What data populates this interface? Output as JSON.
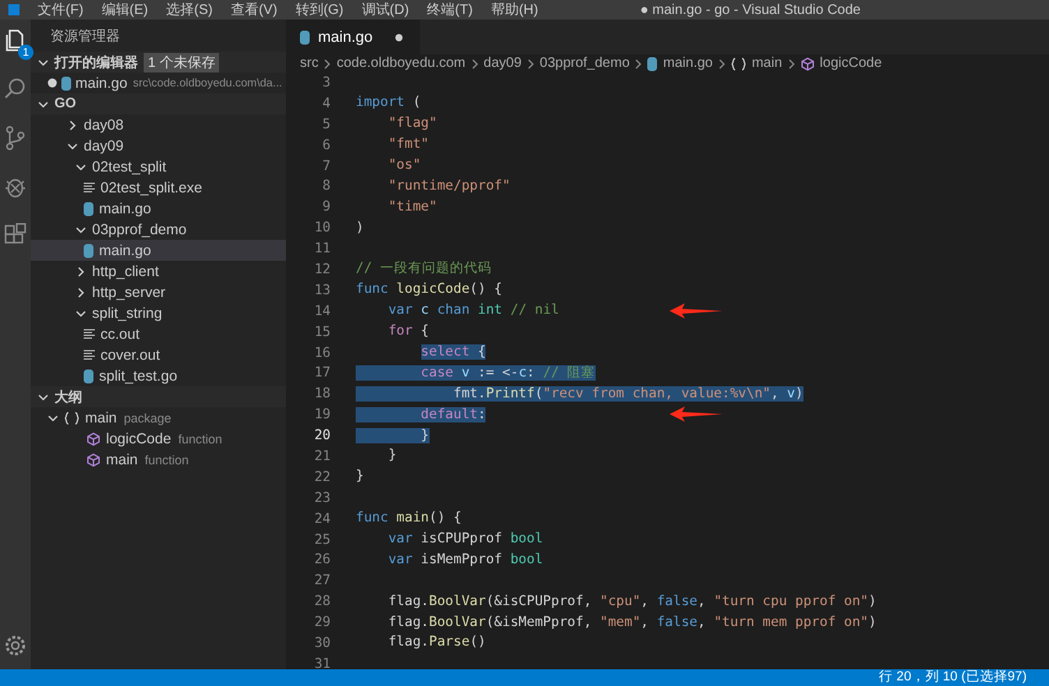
{
  "menu_bar": {
    "items": [
      "文件(F)",
      "编辑(E)",
      "选择(S)",
      "查看(V)",
      "转到(G)",
      "调试(D)",
      "终端(T)",
      "帮助(H)"
    ],
    "title": "● main.go - go - Visual Studio Code"
  },
  "activity_bar": {
    "items": [
      {
        "kind": "files",
        "badge": "1",
        "selected": true
      },
      {
        "kind": "search",
        "selected": false
      },
      {
        "kind": "source-control",
        "selected": false
      },
      {
        "kind": "debug",
        "selected": false
      },
      {
        "kind": "extensions",
        "selected": false
      }
    ],
    "bottom": [
      {
        "kind": "settings"
      }
    ]
  },
  "sidebar": {
    "title": "资源管理器",
    "open_editors": {
      "title": "打开的编辑器",
      "badge": "1 个未保存",
      "expanded": true,
      "items": [
        {
          "name": "main.go",
          "path": "src\\code.oldboyedu.com\\da...",
          "dirty": true
        }
      ]
    },
    "folder": {
      "title": "GO",
      "expanded": true,
      "items": [
        {
          "name": "day08",
          "kind": "folder",
          "expanded": false,
          "selected": false
        },
        {
          "name": "day09",
          "kind": "folder",
          "expanded": true,
          "selected": false,
          "children": [
            {
              "name": "02test_split",
              "kind": "folder",
              "expanded": true,
              "selected": false,
              "children": [
                {
                  "name": "02test_split.exe",
                  "kind": "file",
                  "selected": false
                },
                {
                  "name": "main.go",
                  "kind": "go",
                  "selected": false
                }
              ]
            },
            {
              "name": "03pprof_demo",
              "kind": "folder",
              "expanded": true,
              "selected": false,
              "children": [
                {
                  "name": "main.go",
                  "kind": "go",
                  "selected": true
                }
              ]
            },
            {
              "name": "http_client",
              "kind": "folder",
              "expanded": false,
              "selected": false
            },
            {
              "name": "http_server",
              "kind": "folder",
              "expanded": false,
              "selected": false
            },
            {
              "name": "split_string",
              "kind": "folder",
              "expanded": true,
              "selected": false,
              "children": [
                {
                  "name": "cc.out",
                  "kind": "file",
                  "selected": false
                },
                {
                  "name": "cover.out",
                  "kind": "file",
                  "selected": false
                },
                {
                  "name": "split_test.go",
                  "kind": "go",
                  "selected": false
                }
              ]
            }
          ]
        }
      ]
    },
    "outline": {
      "title": "大纲",
      "expanded": true,
      "items": [
        {
          "name": "main",
          "detail": "package",
          "kind": "package",
          "expanded": true,
          "children": [
            {
              "name": "logicCode",
              "detail": "function",
              "kind": "function"
            },
            {
              "name": "main",
              "detail": "function",
              "kind": "function"
            }
          ]
        }
      ]
    }
  },
  "tabs": [
    {
      "label": "main.go",
      "dirty": true,
      "selected": true
    }
  ],
  "breadcrumb": [
    {
      "label": "src",
      "kind": "folder"
    },
    {
      "label": "code.oldboyedu.com",
      "kind": "folder"
    },
    {
      "label": "day09",
      "kind": "folder"
    },
    {
      "label": "03pprof_demo",
      "kind": "folder"
    },
    {
      "label": "main.go",
      "kind": "go"
    },
    {
      "label": "main",
      "kind": "package"
    },
    {
      "label": "logicCode",
      "kind": "function"
    }
  ],
  "code": [
    {
      "n": "3"
    },
    {
      "n": "4",
      "tokens": [
        {
          "text": "import",
          "kind": "keyword"
        },
        {
          "text": " (",
          "kind": "plain"
        }
      ]
    },
    {
      "n": "5",
      "tokens": [
        {
          "text": "    \"flag\"",
          "kind": "string"
        }
      ]
    },
    {
      "n": "6",
      "tokens": [
        {
          "text": "    \"fmt\"",
          "kind": "string"
        }
      ]
    },
    {
      "n": "7",
      "tokens": [
        {
          "text": "    \"os\"",
          "kind": "string"
        }
      ]
    },
    {
      "n": "8",
      "tokens": [
        {
          "text": "    \"runtime/pprof\"",
          "kind": "string"
        }
      ]
    },
    {
      "n": "9",
      "tokens": [
        {
          "text": "    \"time\"",
          "kind": "string"
        }
      ]
    },
    {
      "n": "10",
      "tokens": [
        {
          "text": ")",
          "kind": "plain"
        }
      ]
    },
    {
      "n": "11"
    },
    {
      "n": "12",
      "tokens": [
        {
          "text": "// 一段有问题的代码",
          "kind": "comment"
        }
      ]
    },
    {
      "n": "13",
      "tokens": [
        {
          "text": "func",
          "kind": "keyword"
        },
        {
          "text": " logicCode",
          "kind": "function"
        },
        {
          "text": "() {",
          "kind": "plain"
        }
      ]
    },
    {
      "n": "14",
      "arrow": true,
      "tokens": [
        {
          "text": "    var",
          "kind": "keyword"
        },
        {
          "text": " c",
          "kind": "variable"
        },
        {
          "text": " chan",
          "kind": "keyword"
        },
        {
          "text": " int",
          "kind": "type"
        },
        {
          "text": " // nil",
          "kind": "comment"
        }
      ]
    },
    {
      "n": "15",
      "tokens": [
        {
          "text": "    for",
          "kind": "control"
        },
        {
          "text": " {",
          "kind": "plain"
        }
      ]
    },
    {
      "n": "16",
      "selected": true,
      "indent_selected": false,
      "tokens": [
        {
          "text": "        select",
          "kind": "control"
        },
        {
          "text": " {",
          "kind": "plain"
        }
      ]
    },
    {
      "n": "17",
      "selected": true,
      "tokens": [
        {
          "text": "        case",
          "kind": "control"
        },
        {
          "text": " v",
          "kind": "variable"
        },
        {
          "text": " := <-",
          "kind": "plain"
        },
        {
          "text": "c",
          "kind": "variable"
        },
        {
          "text": ": ",
          "kind": "plain"
        },
        {
          "text": "// 阻塞",
          "kind": "comment"
        }
      ]
    },
    {
      "n": "18",
      "selected": true,
      "tokens": [
        {
          "text": "            fmt.",
          "kind": "plain"
        },
        {
          "text": "Printf",
          "kind": "function"
        },
        {
          "text": "(",
          "kind": "plain"
        },
        {
          "text": "\"recv from chan, value:%v\\n\"",
          "kind": "string"
        },
        {
          "text": ", ",
          "kind": "plain"
        },
        {
          "text": "v",
          "kind": "variable"
        },
        {
          "text": ")",
          "kind": "plain"
        }
      ]
    },
    {
      "n": "19",
      "selected": true,
      "arrow": true,
      "tokens": [
        {
          "text": "        default",
          "kind": "control"
        },
        {
          "text": ":",
          "kind": "plain"
        }
      ]
    },
    {
      "n": "20",
      "selected": true,
      "current": true,
      "tokens": [
        {
          "text": "        }",
          "kind": "plain"
        }
      ]
    },
    {
      "n": "21",
      "tokens": [
        {
          "text": "    }",
          "kind": "plain"
        }
      ]
    },
    {
      "n": "22",
      "tokens": [
        {
          "text": "}",
          "kind": "plain"
        }
      ]
    },
    {
      "n": "23"
    },
    {
      "n": "24",
      "tokens": [
        {
          "text": "func",
          "kind": "keyword"
        },
        {
          "text": " main",
          "kind": "function"
        },
        {
          "text": "() {",
          "kind": "plain"
        }
      ]
    },
    {
      "n": "25",
      "tokens": [
        {
          "text": "    var",
          "kind": "keyword"
        },
        {
          "text": " isCPUPprof ",
          "kind": "plain"
        },
        {
          "text": "bool",
          "kind": "type"
        }
      ]
    },
    {
      "n": "26",
      "tokens": [
        {
          "text": "    var",
          "kind": "keyword"
        },
        {
          "text": " isMemPprof ",
          "kind": "plain"
        },
        {
          "text": "bool",
          "kind": "type"
        }
      ]
    },
    {
      "n": "27"
    },
    {
      "n": "28",
      "tokens": [
        {
          "text": "    flag.",
          "kind": "plain"
        },
        {
          "text": "BoolVar",
          "kind": "function"
        },
        {
          "text": "(&isCPUPprof, ",
          "kind": "plain"
        },
        {
          "text": "\"cpu\"",
          "kind": "string"
        },
        {
          "text": ", ",
          "kind": "plain"
        },
        {
          "text": "false",
          "kind": "keyword"
        },
        {
          "text": ", ",
          "kind": "plain"
        },
        {
          "text": "\"turn cpu pprof on\"",
          "kind": "string"
        },
        {
          "text": ")",
          "kind": "plain"
        }
      ]
    },
    {
      "n": "29",
      "tokens": [
        {
          "text": "    flag.",
          "kind": "plain"
        },
        {
          "text": "BoolVar",
          "kind": "function"
        },
        {
          "text": "(&isMemPprof, ",
          "kind": "plain"
        },
        {
          "text": "\"mem\"",
          "kind": "string"
        },
        {
          "text": ", ",
          "kind": "plain"
        },
        {
          "text": "false",
          "kind": "keyword"
        },
        {
          "text": ", ",
          "kind": "plain"
        },
        {
          "text": "\"turn mem pprof on\"",
          "kind": "string"
        },
        {
          "text": ")",
          "kind": "plain"
        }
      ]
    },
    {
      "n": "30",
      "tokens": [
        {
          "text": "    flag.",
          "kind": "plain"
        },
        {
          "text": "Parse",
          "kind": "function"
        },
        {
          "text": "()",
          "kind": "plain"
        }
      ]
    },
    {
      "n": "31"
    }
  ],
  "status_bar": {
    "position": "行 20，列 10 (已选择97)"
  }
}
